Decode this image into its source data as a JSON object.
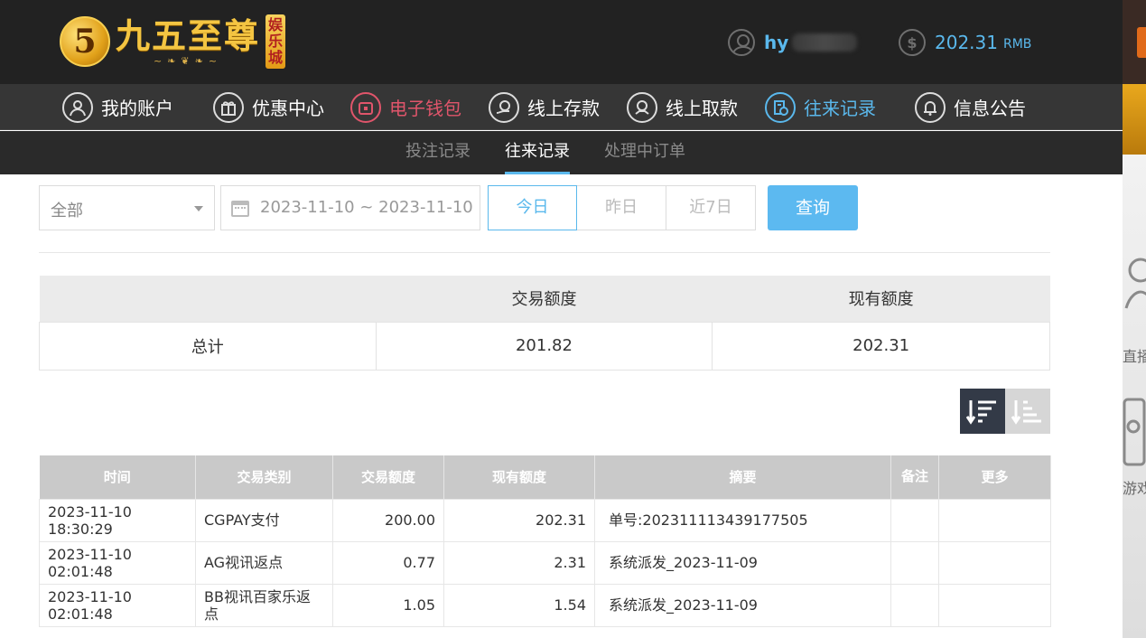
{
  "brand": {
    "badge": "5",
    "name": "九五至尊",
    "subtitle": "",
    "tag": [
      "娱",
      "乐",
      "城"
    ]
  },
  "user": {
    "name": "hy"
  },
  "balance": {
    "amount": "202.31",
    "unit": "RMB",
    "symbol": "$"
  },
  "main_nav": [
    {
      "label": "我的账户",
      "icon": "user-icon"
    },
    {
      "label": "优惠中心",
      "icon": "gift-icon"
    },
    {
      "label": "电子钱包",
      "icon": "wallet-icon"
    },
    {
      "label": "线上存款",
      "icon": "deposit-icon"
    },
    {
      "label": "线上取款",
      "icon": "withdraw-icon"
    },
    {
      "label": "往来记录",
      "icon": "records-icon"
    },
    {
      "label": "信息公告",
      "icon": "bell-icon"
    }
  ],
  "sub_nav": [
    {
      "label": "投注记录"
    },
    {
      "label": "往来记录",
      "active": true
    },
    {
      "label": "处理中订单"
    }
  ],
  "filters": {
    "type_value": "全部",
    "date_range": "2023-11-10 ~ 2023-11-10",
    "quick": [
      "今日",
      "昨日",
      "近7日"
    ],
    "query_label": "查询"
  },
  "summary": {
    "headers": [
      "",
      "交易额度",
      "现有额度"
    ],
    "row": {
      "label": "总计",
      "amount": "201.82",
      "current": "202.31"
    }
  },
  "records": {
    "headers": [
      "时间",
      "交易类别",
      "交易额度",
      "现有额度",
      "摘要",
      "备注",
      "更多"
    ],
    "rows": [
      {
        "time": "2023-11-10 18:30:29",
        "type": "CGPAY支付",
        "amount": "200.00",
        "current": "202.31",
        "summary": "单号:202311113439177505",
        "note": "",
        "more": ""
      },
      {
        "time": "2023-11-10 02:01:48",
        "type": "AG视讯返点",
        "amount": "0.77",
        "current": "2.31",
        "summary": "系统派发_2023-11-09",
        "note": "",
        "more": ""
      },
      {
        "time": "2023-11-10 02:01:48",
        "type": "BB视讯百家乐返点",
        "amount": "1.05",
        "current": "1.54",
        "summary": "系统派发_2023-11-09",
        "note": "",
        "more": ""
      }
    ]
  },
  "side_labels": [
    "直播",
    "游戏"
  ],
  "colors": {
    "header_bg": "#222222",
    "nav_bg": "#363636",
    "subnav_bg": "#2a2a2a",
    "accent": "#5ab8ec",
    "wallet": "#e0556b",
    "gold": "#f4c542",
    "query_button": "#5cb9f0",
    "table_head": "#c9c9c9"
  }
}
